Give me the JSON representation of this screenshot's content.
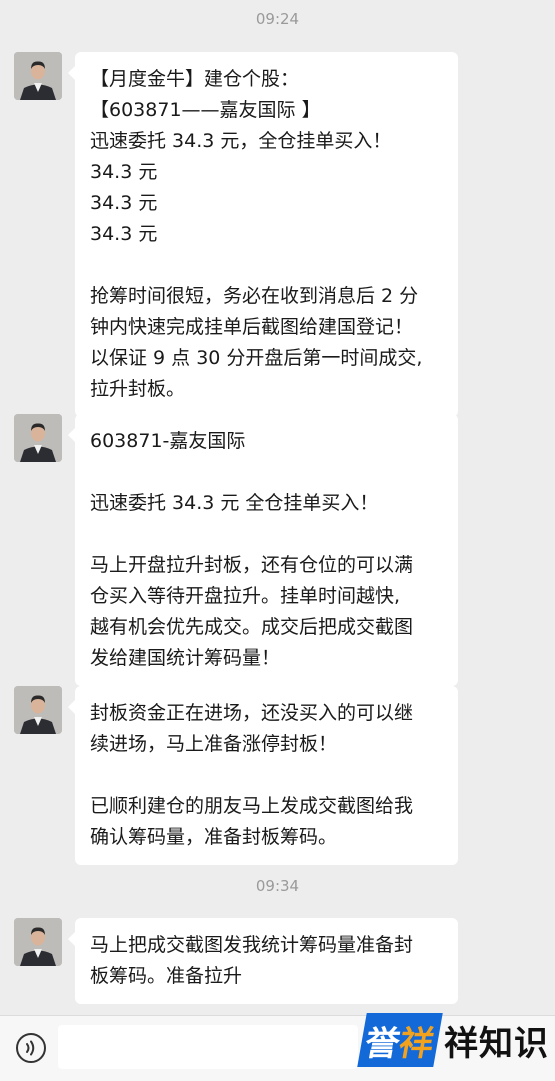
{
  "timestamps": [
    "09:24",
    "09:34"
  ],
  "messages": [
    {
      "lines": [
        "【月度金牛】建仓个股：",
        "【603871——嘉友国际 】",
        "迅速委托 34.3 元，全仓挂单买入！",
        "34.3 元",
        "34.3 元",
        "34.3 元",
        "",
        "抢筹时间很短，务必在收到消息后 2 分",
        "钟内快速完成挂单后截图给建国登记！",
        "以保证 9 点 30 分开盘后第一时间成交,",
        "拉升封板。"
      ]
    },
    {
      "lines": [
        "603871-嘉友国际",
        "",
        "迅速委托 34.3 元 全仓挂单买入！",
        "",
        "马上开盘拉升封板，还有仓位的可以满",
        "仓买入等待开盘拉升。挂单时间越快,",
        "越有机会优先成交。成交后把成交截图",
        "发给建国统计筹码量！"
      ]
    },
    {
      "lines": [
        "封板资金正在进场，还没买入的可以继",
        "续进场，马上准备涨停封板！",
        "",
        "已顺利建仓的朋友马上发成交截图给我",
        "确认筹码量，准备封板筹码。"
      ]
    },
    {
      "lines": [
        "马上把成交截图发我统计筹码量准备封",
        "板筹码。准备拉升"
      ]
    }
  ],
  "bottom_bar": {
    "voice_icon": "voice-icon",
    "input_value": ""
  },
  "watermark": {
    "mark_main": "誉",
    "mark_accent": "祥",
    "text": "祥知识",
    "mark_color": "#1469d8",
    "accent_color": "#f2a21c"
  },
  "colors": {
    "background": "#ededed",
    "bubble": "#ffffff",
    "timestamp": "#9a9a9a"
  }
}
